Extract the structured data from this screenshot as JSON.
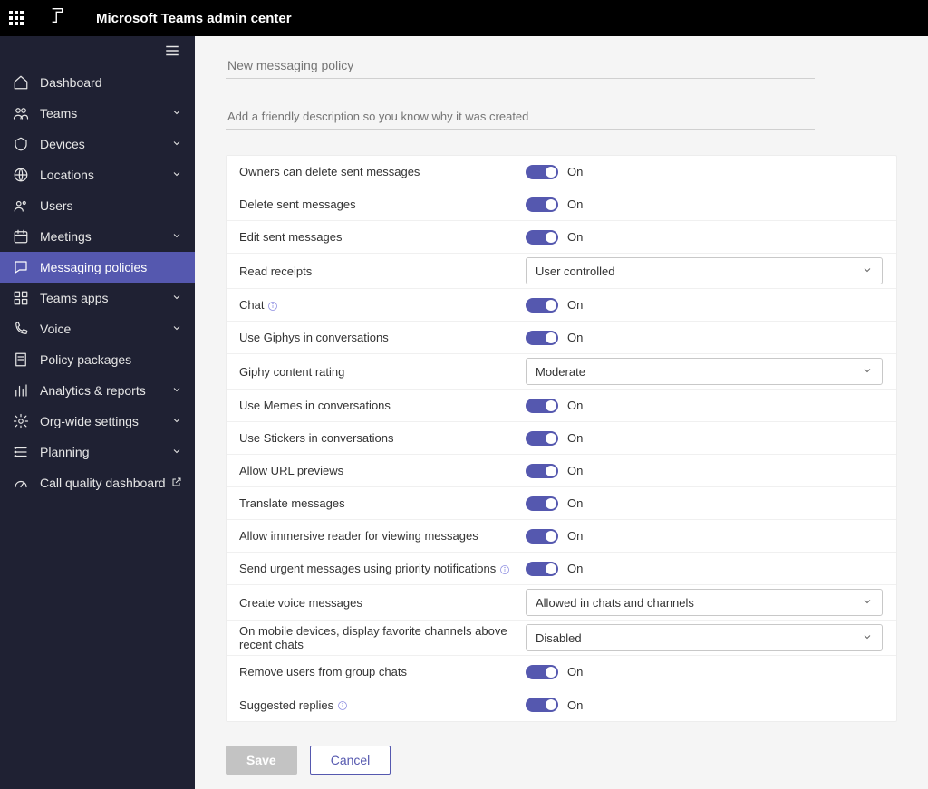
{
  "header": {
    "app_title": "Microsoft Teams admin center"
  },
  "sidebar": {
    "items": [
      {
        "label": "Dashboard",
        "icon": "home",
        "expandable": false
      },
      {
        "label": "Teams",
        "icon": "people",
        "expandable": true
      },
      {
        "label": "Devices",
        "icon": "device",
        "expandable": true
      },
      {
        "label": "Locations",
        "icon": "globe",
        "expandable": true
      },
      {
        "label": "Users",
        "icon": "users",
        "expandable": false
      },
      {
        "label": "Meetings",
        "icon": "calendar",
        "expandable": true
      },
      {
        "label": "Messaging policies",
        "icon": "chat",
        "expandable": false,
        "selected": true
      },
      {
        "label": "Teams apps",
        "icon": "apps",
        "expandable": true
      },
      {
        "label": "Voice",
        "icon": "phone",
        "expandable": true
      },
      {
        "label": "Policy packages",
        "icon": "policy",
        "expandable": false
      },
      {
        "label": "Analytics & reports",
        "icon": "analytics",
        "expandable": true
      },
      {
        "label": "Org-wide settings",
        "icon": "gear",
        "expandable": true
      },
      {
        "label": "Planning",
        "icon": "planning",
        "expandable": true
      },
      {
        "label": "Call quality dashboard",
        "icon": "gauge",
        "expandable": false,
        "external": true
      }
    ]
  },
  "form": {
    "name_placeholder": "New messaging policy",
    "description_placeholder": "Add a friendly description so you know why it was created",
    "toggle_on_label": "On",
    "rows": [
      {
        "type": "toggle",
        "label": "Owners can delete sent messages"
      },
      {
        "type": "toggle",
        "label": "Delete sent messages"
      },
      {
        "type": "toggle",
        "label": "Edit sent messages"
      },
      {
        "type": "select",
        "label": "Read receipts",
        "value": "User controlled"
      },
      {
        "type": "toggle",
        "label": "Chat",
        "info": true
      },
      {
        "type": "toggle",
        "label": "Use Giphys in conversations"
      },
      {
        "type": "select",
        "label": "Giphy content rating",
        "value": "Moderate"
      },
      {
        "type": "toggle",
        "label": "Use Memes in conversations"
      },
      {
        "type": "toggle",
        "label": "Use Stickers in conversations"
      },
      {
        "type": "toggle",
        "label": "Allow URL previews"
      },
      {
        "type": "toggle",
        "label": "Translate messages"
      },
      {
        "type": "toggle",
        "label": "Allow immersive reader for viewing messages"
      },
      {
        "type": "toggle",
        "label": "Send urgent messages using priority notifications",
        "info": true
      },
      {
        "type": "select",
        "label": "Create voice messages",
        "value": "Allowed in chats and channels"
      },
      {
        "type": "select",
        "label": "On mobile devices, display favorite channels above recent chats",
        "value": "Disabled"
      },
      {
        "type": "toggle",
        "label": "Remove users from group chats"
      },
      {
        "type": "toggle",
        "label": "Suggested replies",
        "info": true
      }
    ],
    "buttons": {
      "save": "Save",
      "cancel": "Cancel"
    }
  }
}
